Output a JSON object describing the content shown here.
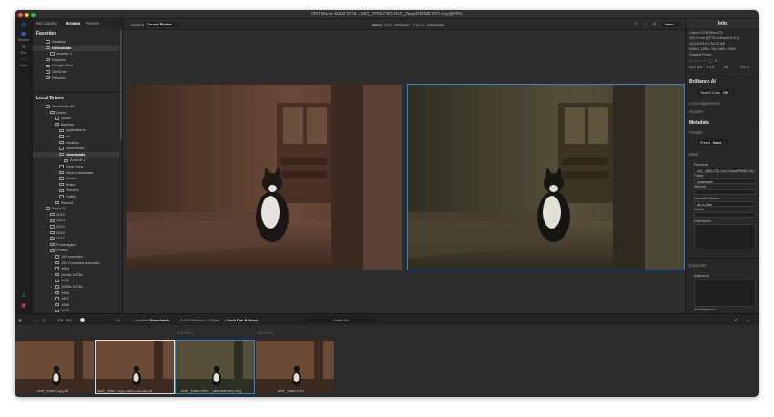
{
  "app": {
    "title": "ON1 Photo RAW 2024 - IMG_3256-CR2-DxO_DeepPRIMEXD2.dng@18%"
  },
  "leftnav": {
    "items": [
      {
        "label": "Browse",
        "icon": "grid-icon"
      },
      {
        "label": "Edit",
        "icon": "sliders-icon"
      },
      {
        "label": "More",
        "icon": "dots-icon"
      }
    ]
  },
  "sidebar": {
    "tabs": [
      "My Catalog",
      "Browse",
      "Presets"
    ],
    "favorites_title": "Favorites",
    "favorites": [
      {
        "label": "Desktop",
        "level": 0
      },
      {
        "label": "Downloads",
        "level": 0,
        "selected": true
      },
      {
        "label": "Archive 2",
        "level": 1
      },
      {
        "label": "Dropbox",
        "level": 0
      },
      {
        "label": "Google Drive",
        "level": 0
      },
      {
        "label": "OneDrive",
        "level": 0
      },
      {
        "label": "Pictures",
        "level": 0
      }
    ],
    "local_title": "Local Drives",
    "local": [
      {
        "label": "Macintosh HD",
        "level": 0
      },
      {
        "label": "Users",
        "level": 1
      },
      {
        "label": "Guest",
        "level": 2
      },
      {
        "label": "tiannies",
        "level": 2
      },
      {
        "label": "Applications",
        "level": 3
      },
      {
        "label": "bin",
        "level": 3
      },
      {
        "label": "Desktop",
        "level": 3
      },
      {
        "label": "Documents",
        "level": 3
      },
      {
        "label": "Downloads",
        "level": 3,
        "selected": true
      },
      {
        "label": "Archive 2",
        "level": 4
      },
      {
        "label": "Drive-Sync",
        "level": 3
      },
      {
        "label": "Drive Downloads",
        "level": 3
      },
      {
        "label": "Movies",
        "level": 3
      },
      {
        "label": "Music",
        "level": 3
      },
      {
        "label": "Pictures",
        "level": 3
      },
      {
        "label": "Public",
        "level": 3
      },
      {
        "label": "Shared",
        "level": 2
      },
      {
        "label": "Ray's T7",
        "level": 0
      },
      {
        "label": "2012",
        "level": 1
      },
      {
        "label": "2013",
        "level": 1
      },
      {
        "label": "2014",
        "level": 1
      },
      {
        "label": "2016",
        "level": 1
      },
      {
        "label": "2017",
        "level": 1
      },
      {
        "label": "FotoMagico",
        "level": 1
      },
      {
        "label": "Photos",
        "level": 1
      },
      {
        "label": "100 countries",
        "level": 2
      },
      {
        "label": "100 Countries upscaled",
        "level": 2
      },
      {
        "label": "1964",
        "level": 2
      },
      {
        "label": "1964b-1973b",
        "level": 2
      },
      {
        "label": "1965",
        "level": 2
      },
      {
        "label": "1965b-1973b",
        "level": 2
      },
      {
        "label": "1966",
        "level": 2
      },
      {
        "label": "1967",
        "level": 2
      },
      {
        "label": "1968",
        "level": 2
      },
      {
        "label": "1969",
        "level": 2
      },
      {
        "label": "1970",
        "level": 2
      },
      {
        "label": "1971",
        "level": 2
      }
    ]
  },
  "toolbar": {
    "search_label": "Search",
    "search_scope": "Current Photos",
    "filters": [
      "Name",
      "Text",
      "Attribute",
      "Faces",
      "Metadata"
    ],
    "sort_label": "None"
  },
  "viewer": {
    "photos": [
      {
        "name": "IMG_3256 copy-TPAI-denoise.tif",
        "selected": false
      },
      {
        "name": "IMG_3256-CR2-DxO_DeepPRIMEXD2.dng",
        "selected": true
      }
    ]
  },
  "right_panel": {
    "info_title": "Info",
    "camera": "Canon EOS Rebel T5",
    "lens": "100.0 mm (EF75-300mm f/4-5.6)",
    "datetime": "12/24/2015 5:35:32 AM",
    "dimensions": "5184 x 3456 • 35.3 MB • RAW",
    "original": "Original Photo",
    "exif": [
      "ISO 100",
      "6.3 s",
      "f/5",
      "EV 0"
    ],
    "brilliance_title": "Brilliance AI",
    "tone_label": "Tone & Color",
    "tone_value": "Off",
    "local_adj": "Local Adjustments",
    "options": "Options",
    "metadata_title": "Metadata",
    "presets_label": "Presets",
    "preset_label": "Preset",
    "preset_value": "None",
    "basic_label": "Basic",
    "filename_label": "Filename",
    "filename_value": "IMG_3256-CR2-DxO_DeepPRIMEXD2.dng",
    "folder_label": "Folder",
    "folder_value": "Downloads",
    "albums_label": "Albums",
    "status_label": "Metadata Status",
    "status_value": "Up to Date",
    "author_label": "Author",
    "description_label": "Description",
    "keywords_title": "Keywords",
    "keywords_label": "Keywords",
    "add_keyword": "Add Keyword"
  },
  "statusbar": {
    "fit": "Fit",
    "zoom": "100",
    "thumb_size": "18",
    "location_label": "Location",
    "location_value": "Downloads",
    "selection": "2 of 2 Selected • 5 Total",
    "lock": "Lock Pan & Zoom",
    "match": "Match All"
  },
  "filmstrip": {
    "items": [
      {
        "name": "IMG_3256 copy.tif",
        "state": "none"
      },
      {
        "name": "IMG_3256 copy-TPAI-denoise.tif",
        "state": "highlight"
      },
      {
        "name": "IMG_3256-CR2-...pPRIMEXD2.dng",
        "state": "selected"
      },
      {
        "name": "IMG_3256.CR2",
        "state": "none"
      }
    ],
    "stars": "☆☆☆☆☆"
  },
  "colors": {
    "accent": "#2f84e0",
    "window_bg": "#262626",
    "panel_bg": "#2a2a2a"
  }
}
